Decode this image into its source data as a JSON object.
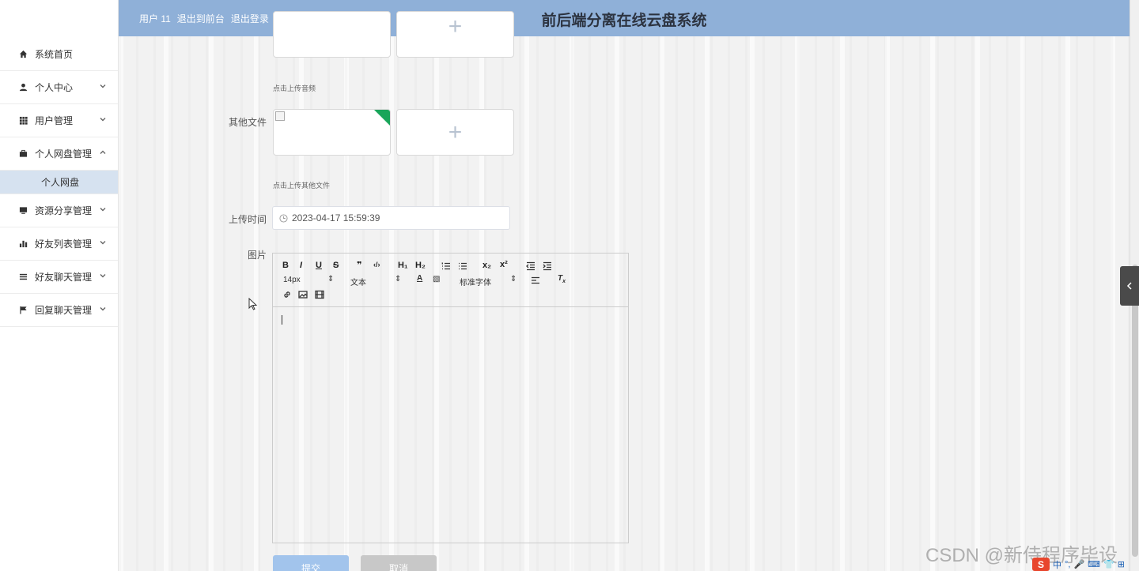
{
  "header": {
    "user_label": "用户 11",
    "back_link": "退出到前台",
    "logout_link": "退出登录",
    "title": "前后端分离在线云盘系统"
  },
  "sidebar": {
    "items": [
      {
        "label": "系统首页",
        "icon": "home-icon"
      },
      {
        "label": "个人中心",
        "icon": "user-icon"
      },
      {
        "label": "用户管理",
        "icon": "grid-icon"
      },
      {
        "label": "个人网盘管理",
        "icon": "briefcase-icon"
      },
      {
        "label": "资源分享管理",
        "icon": "monitor-icon"
      },
      {
        "label": "好友列表管理",
        "icon": "bar-chart-icon"
      },
      {
        "label": "好友聊天管理",
        "icon": "list-icon"
      },
      {
        "label": "回复聊天管理",
        "icon": "flag-icon"
      }
    ],
    "sub_item": "个人网盘"
  },
  "form": {
    "audio_hint": "点击上传音频",
    "other_files_label": "其他文件",
    "other_files_hint": "点击上传其他文件",
    "upload_time_label": "上传时间",
    "upload_time_value": "2023-04-17 15:59:39",
    "image_label": "图片"
  },
  "editor": {
    "buttons": {
      "bold": "B",
      "italic": "I",
      "underline": "U",
      "strike": "S",
      "quote": "❞",
      "code": "‹/›",
      "h1": "H₁",
      "h2": "H₂",
      "sub": "x₂",
      "sup": "x²"
    },
    "font_size": "14px",
    "text_type": "文本",
    "font_family": "标准字体"
  },
  "actions": {
    "submit": "提交",
    "cancel": "取消"
  },
  "watermark": "CSDN @新侍程序毕设",
  "ime": {
    "logo": "S",
    "mode": "中"
  },
  "colors": {
    "header_bg": "#8fb0d8",
    "active_sub_bg": "#d6e2f0",
    "submit_bg": "#a2c4ec",
    "corner_badge": "#19a55a"
  }
}
